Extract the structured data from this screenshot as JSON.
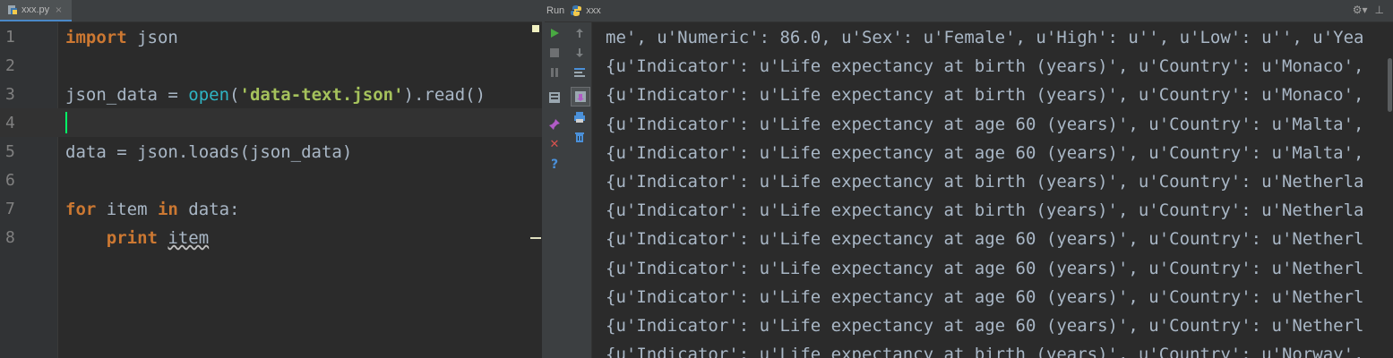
{
  "editor": {
    "tab_label": "xxx.py",
    "tab_close": "×",
    "lines": [
      {
        "num": "1",
        "code": [
          {
            "t": "import",
            "c": "kw"
          },
          {
            "t": " json"
          }
        ]
      },
      {
        "num": "2",
        "code": []
      },
      {
        "num": "3",
        "code": [
          {
            "t": "json_data = "
          },
          {
            "t": "open",
            "c": "bi"
          },
          {
            "t": "("
          },
          {
            "t": "'data-text.json'",
            "c": "str2"
          },
          {
            "t": ").read()"
          }
        ]
      },
      {
        "num": "4",
        "code": [],
        "current": true
      },
      {
        "num": "5",
        "code": [
          {
            "t": "data = json.loads(json_data)"
          }
        ]
      },
      {
        "num": "6",
        "code": []
      },
      {
        "num": "7",
        "code": [
          {
            "t": "for",
            "c": "kw"
          },
          {
            "t": " item "
          },
          {
            "t": "in",
            "c": "kw"
          },
          {
            "t": " data:"
          }
        ]
      },
      {
        "num": "8",
        "code": [
          {
            "t": "    "
          },
          {
            "t": "print",
            "c": "kw"
          },
          {
            "t": " "
          },
          {
            "t": "item",
            "c": "squig"
          }
        ]
      }
    ]
  },
  "run": {
    "title": "Run",
    "config_name": "xxx",
    "output": [
      "me', u'Numeric': 86.0, u'Sex': u'Female', u'High': u'', u'Low': u'', u'Yea",
      "{u'Indicator': u'Life expectancy at birth (years)', u'Country': u'Monaco',",
      "{u'Indicator': u'Life expectancy at birth (years)', u'Country': u'Monaco',",
      "{u'Indicator': u'Life expectancy at age 60 (years)', u'Country': u'Malta',",
      "{u'Indicator': u'Life expectancy at age 60 (years)', u'Country': u'Malta',",
      "{u'Indicator': u'Life expectancy at birth (years)', u'Country': u'Netherla",
      "{u'Indicator': u'Life expectancy at birth (years)', u'Country': u'Netherla",
      "{u'Indicator': u'Life expectancy at age 60 (years)', u'Country': u'Netherl",
      "{u'Indicator': u'Life expectancy at age 60 (years)', u'Country': u'Netherl",
      "{u'Indicator': u'Life expectancy at age 60 (years)', u'Country': u'Netherl",
      "{u'Indicator': u'Life expectancy at age 60 (years)', u'Country': u'Netherl",
      "{u'Indicator': u'Life expectancy at birth (years)', u'Country': u'Norway',"
    ]
  },
  "colors": {
    "accent_run": "#49a942",
    "close_red": "#d9534f",
    "help_blue": "#4a90d9",
    "caret": "#00ff66"
  }
}
